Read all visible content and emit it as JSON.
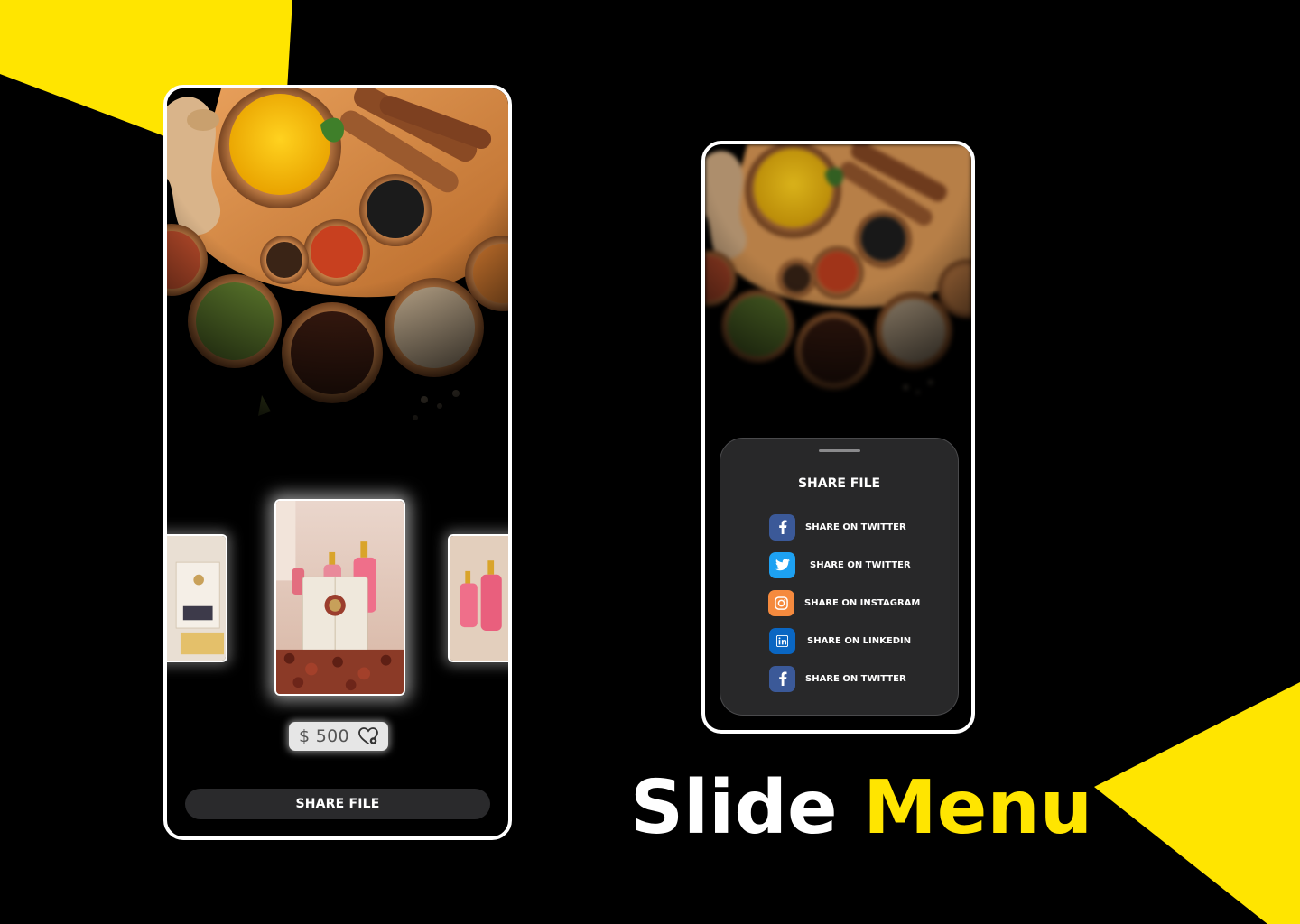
{
  "colors": {
    "accent_yellow": "#ffe500",
    "background": "#000000",
    "frame": "#ffffff",
    "button_bg": "#2a2a2c",
    "sheet_bg": "#282829",
    "facebook": "#3b5998",
    "twitter": "#1da1f2",
    "instagram": "#f58a3e",
    "linkedin": "#0a66c2"
  },
  "left_phone": {
    "hero_image": "spices-bowls-photo",
    "carousel": {
      "items": [
        {
          "image": "skincare-box-photo"
        },
        {
          "image": "soap-and-serum-photo"
        },
        {
          "image": "serum-bottles-photo"
        }
      ],
      "active_index": 1
    },
    "price": "$ 500",
    "price_icon": "heart-settings-icon",
    "share_button_label": "SHARE FILE"
  },
  "right_phone": {
    "hero_image": "spices-bowls-photo-blurred",
    "sheet": {
      "title": "SHARE FILE",
      "items": [
        {
          "icon": "facebook-icon",
          "label": "SHARE ON TWITTER"
        },
        {
          "icon": "twitter-icon",
          "label": "SHARE ON TWITTER"
        },
        {
          "icon": "instagram-icon",
          "label": "SHARE ON INSTAGRAM"
        },
        {
          "icon": "linkedin-icon",
          "label": "SHARE ON LINKEDIN"
        },
        {
          "icon": "facebook-icon",
          "label": "SHARE ON TWITTER"
        }
      ]
    }
  },
  "headline": {
    "word1": "Slide",
    "word2": "Menu"
  }
}
